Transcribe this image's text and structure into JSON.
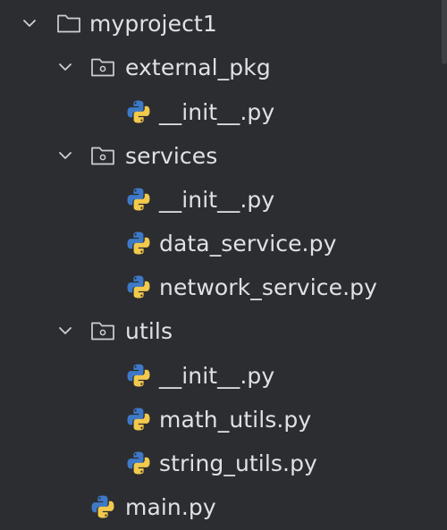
{
  "tree": {
    "root": {
      "label": "myproject1",
      "expanded": true
    },
    "folders": [
      {
        "label": "external_pkg",
        "expanded": true,
        "files": [
          {
            "label": "__init__.py",
            "icon": "python-icon"
          }
        ]
      },
      {
        "label": "services",
        "expanded": true,
        "files": [
          {
            "label": "__init__.py",
            "icon": "python-icon"
          },
          {
            "label": "data_service.py",
            "icon": "python-icon"
          },
          {
            "label": "network_service.py",
            "icon": "python-icon"
          }
        ]
      },
      {
        "label": "utils",
        "expanded": true,
        "files": [
          {
            "label": "__init__.py",
            "icon": "python-icon"
          },
          {
            "label": "math_utils.py",
            "icon": "python-icon"
          },
          {
            "label": "string_utils.py",
            "icon": "python-icon"
          }
        ]
      }
    ],
    "root_files": [
      {
        "label": "main.py",
        "icon": "python-icon"
      }
    ]
  },
  "colors": {
    "background": "#2b2d30",
    "text": "#dfe1e5",
    "icon_outline": "#ced0d6",
    "python_blue": "#3e79c8",
    "python_yellow": "#f2c94c"
  }
}
